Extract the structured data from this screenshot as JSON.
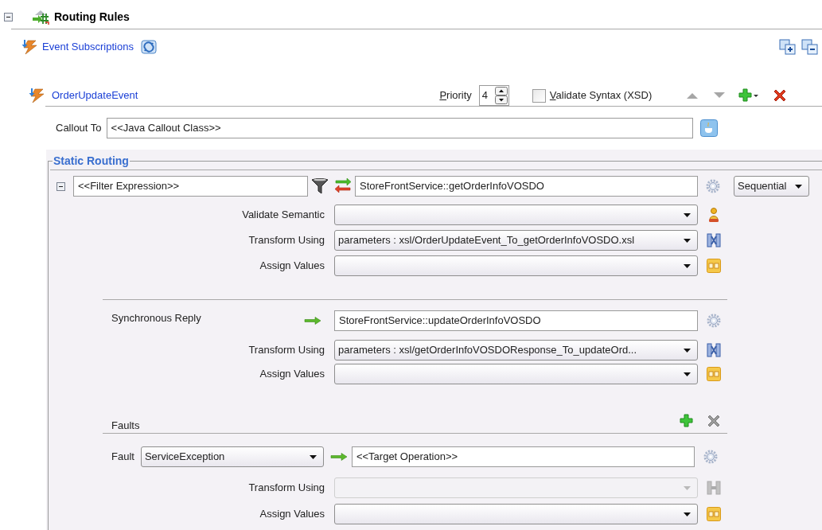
{
  "header": {
    "title": "Routing Rules",
    "expanded": true
  },
  "subscriptions": {
    "label": "Event Subscriptions"
  },
  "event": {
    "name": "OrderUpdateEvent",
    "priority_label": "Priority",
    "priority": "4",
    "validate_syntax": {
      "label": "Validate Syntax (XSD)",
      "checked": false
    }
  },
  "callout": {
    "label": "Callout To",
    "value": "<<Java Callout Class>>"
  },
  "static_routing": {
    "title": "Static Routing",
    "expanded": true,
    "filter": "<<Filter Expression>>",
    "target": "StoreFrontService::getOrderInfoVOSDO",
    "execution": "Sequential",
    "rows": [
      {
        "kind": "validate",
        "label": "Validate Semantic",
        "disabled": false
      },
      {
        "kind": "transform",
        "label": "Transform Using",
        "value": "parameters : xsl/OrderUpdateEvent_To_getOrderInfoVOSDO.xsl",
        "disabled": false
      },
      {
        "kind": "assign",
        "label": "Assign Values",
        "disabled": false
      }
    ],
    "reply": {
      "label": "Synchronous Reply",
      "target": "StoreFrontService::updateOrderInfoVOSDO",
      "rows": [
        {
          "kind": "transform",
          "label": "Transform Using",
          "value": "parameters : xsl/getOrderInfoVOSDOResponse_To_updateOrd...",
          "disabled": false
        },
        {
          "kind": "assign",
          "label": "Assign Values",
          "disabled": false
        }
      ]
    },
    "faults": {
      "title": "Faults",
      "items": [
        {
          "label": "Fault",
          "name": "ServiceException",
          "target": "<<Target Operation>>",
          "rows": [
            {
              "kind": "transform",
              "label": "Transform Using",
              "disabled": true
            },
            {
              "kind": "assign",
              "label": "Assign Values",
              "disabled": false
            }
          ]
        }
      ]
    }
  }
}
